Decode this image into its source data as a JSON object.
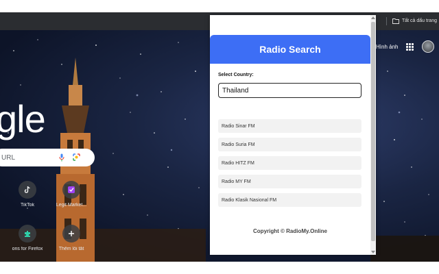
{
  "browser": {
    "bookmarks_label": "Tất cả dấu trang"
  },
  "newtab": {
    "logo_partial": "gle",
    "search_placeholder": "URL",
    "images_link": "Hình ảnh",
    "shortcuts": [
      {
        "label": "TikTok",
        "icon": "tiktok-icon"
      },
      {
        "label": "Legit Market...",
        "icon": "checklist-icon"
      },
      {
        "label": "ons for Firefox",
        "icon": "firefox-addon-icon"
      },
      {
        "label": "Thêm lối tắt",
        "icon": "plus-icon"
      }
    ]
  },
  "popup": {
    "title": "Radio Search",
    "country_label": "Select Country:",
    "country_value": "Thailand",
    "stations": [
      "Radio Sinar FM",
      "Radio Suria FM",
      "Radio HITZ FM",
      "Radio MY FM",
      "Radio Klasik Nasional FM"
    ],
    "copyright": "Copyright © RadioMy.Online"
  },
  "colors": {
    "popup_header": "#3d6ef5",
    "ntp_sky": "#1a2543"
  }
}
